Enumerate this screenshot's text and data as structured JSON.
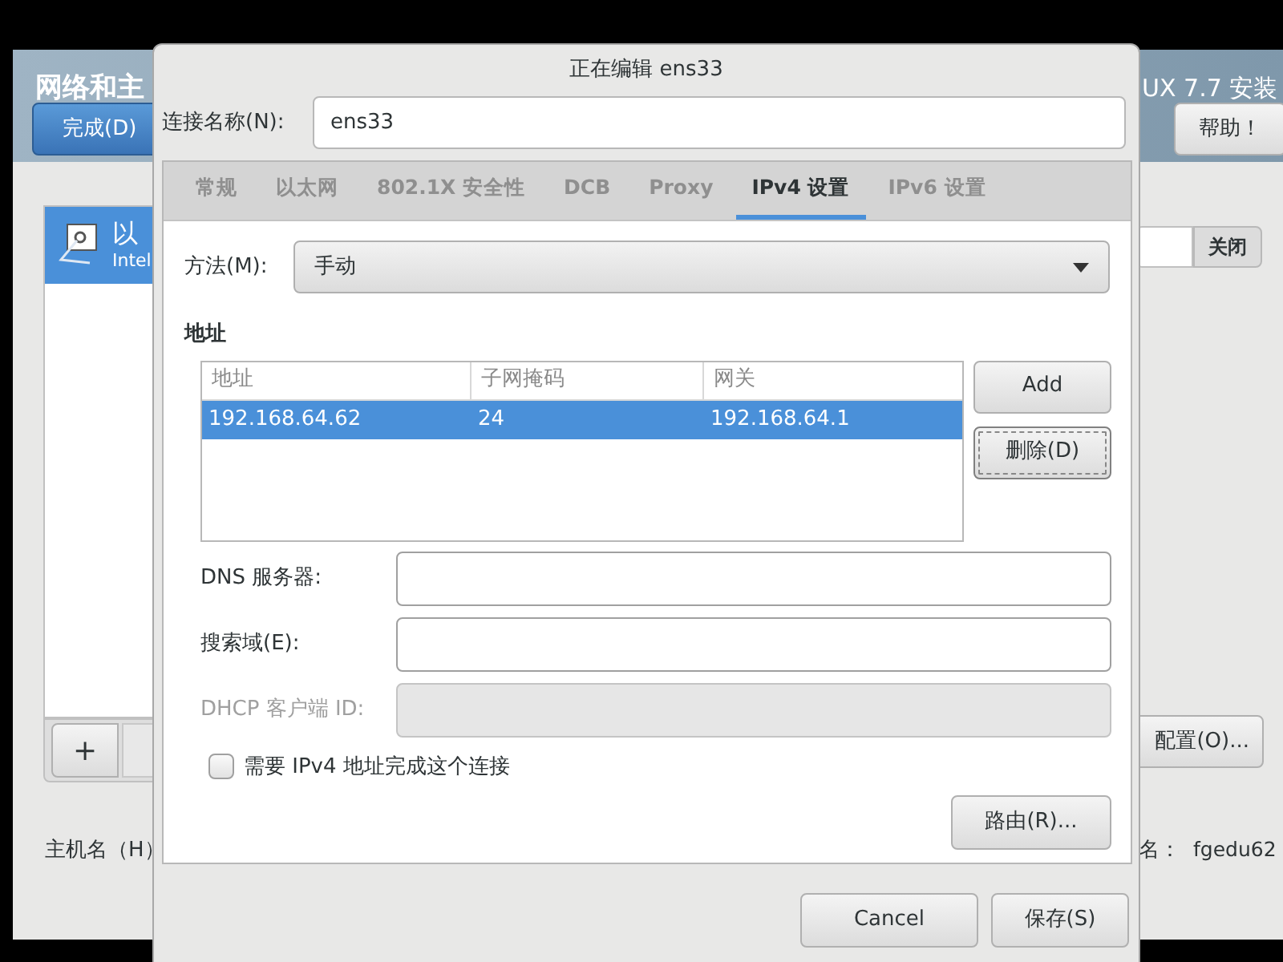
{
  "background_window": {
    "title": "网络和主",
    "title_right": "UX 7.7 安装",
    "done_button": "完成(D)",
    "help_button": "帮助！",
    "connections": [
      {
        "name": "以",
        "detail": "Intel",
        "selected": true
      }
    ],
    "add_button": "+",
    "close_button": "关闭",
    "configure_button": "配置(O)...",
    "hostname_label": "主机名（H）",
    "current_hostname_label": "名：",
    "current_hostname": "fgedu62"
  },
  "dialog": {
    "title": "正在编辑 ens33",
    "connection_name_label": "连接名称(N):",
    "connection_name": "ens33",
    "tabs": [
      {
        "label": "常规",
        "selected": false
      },
      {
        "label": "以太网",
        "selected": false
      },
      {
        "label": "802.1X 安全性",
        "selected": false
      },
      {
        "label": "DCB",
        "selected": false
      },
      {
        "label": "Proxy",
        "selected": false
      },
      {
        "label": "IPv4 设置",
        "selected": true
      },
      {
        "label": "IPv6 设置",
        "selected": false
      }
    ],
    "method_label": "方法(M):",
    "method_value": "手动",
    "addresses_title": "地址",
    "address_table": {
      "columns": [
        "地址",
        "子网掩码",
        "网关"
      ],
      "rows": [
        {
          "cells": [
            "192.168.64.62",
            "24",
            "192.168.64.1"
          ],
          "selected": true
        }
      ]
    },
    "add_button": "Add",
    "delete_button": {
      "label": "删除(D)",
      "focused": true
    },
    "fields": [
      {
        "label": "DNS 服务器:",
        "disabled": false
      },
      {
        "label": "搜索域(E):",
        "disabled": false
      },
      {
        "label": "DHCP 客户端 ID:",
        "disabled": true
      }
    ],
    "require_ipv4": {
      "label": "需要 IPv4 地址完成这个连接",
      "checked": false
    },
    "routes_button": "路由(R)...",
    "cancel_button": "Cancel",
    "save_button": "保存(S)"
  }
}
